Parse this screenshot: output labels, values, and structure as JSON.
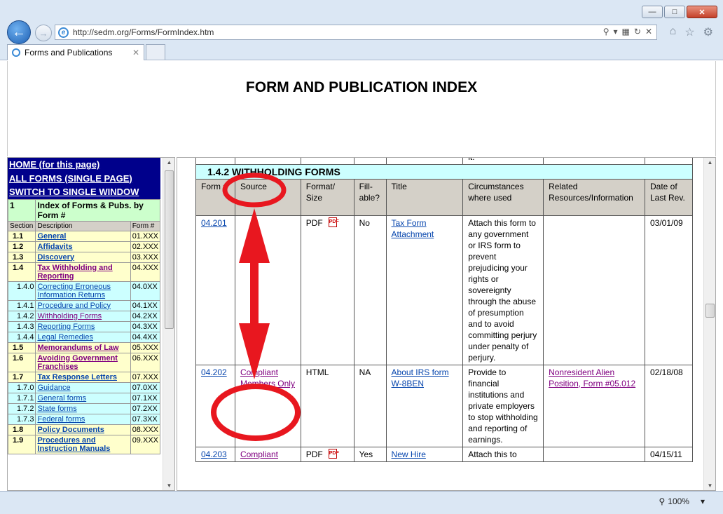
{
  "browser": {
    "url": "http://sedm.org/Forms/FormIndex.htm",
    "tab_title": "Forms and Publications",
    "zoom": "100%"
  },
  "page": {
    "title": "FORM AND PUBLICATION INDEX"
  },
  "left_nav": {
    "links": [
      "HOME (for this page)",
      "ALL FORMS (SINGLE PAGE)",
      "SWITCH TO SINGLE WINDOW"
    ],
    "index_header": {
      "num": "1",
      "label": "Index of Forms & Pubs. by Form #"
    },
    "columns": {
      "section": "Section",
      "description": "Description",
      "form": "Form #"
    },
    "rows": [
      {
        "sec": "1.1",
        "desc": "General",
        "form": "01.XXX",
        "style": "y"
      },
      {
        "sec": "1.2",
        "desc": "Affidavits",
        "form": "02.XXX",
        "style": "y"
      },
      {
        "sec": "1.3",
        "desc": "Discovery",
        "form": "03.XXX",
        "style": "y"
      },
      {
        "sec": "1.4",
        "desc": "Tax Withholding and Reporting",
        "form": "04.XXX",
        "style": "y",
        "visited": true
      },
      {
        "sec": "1.4.0",
        "desc": "Correcting Erroneous Information Returns",
        "form": "04.0XX",
        "style": "c"
      },
      {
        "sec": "1.4.1",
        "desc": "Procedure and Policy",
        "form": "04.1XX",
        "style": "c"
      },
      {
        "sec": "1.4.2",
        "desc": "Withholding Forms",
        "form": "04.2XX",
        "style": "c",
        "visited": true
      },
      {
        "sec": "1.4.3",
        "desc": "Reporting Forms",
        "form": "04.3XX",
        "style": "c"
      },
      {
        "sec": "1.4.4",
        "desc": "Legal Remedies",
        "form": "04.4XX",
        "style": "c"
      },
      {
        "sec": "1.5",
        "desc": "Memorandums of Law",
        "form": "05.XXX",
        "style": "y",
        "visited": true
      },
      {
        "sec": "1.6",
        "desc": "Avoiding Government Franchises",
        "form": "06.XXX",
        "style": "y",
        "visited": true
      },
      {
        "sec": "1.7",
        "desc": "Tax Response Letters",
        "form": "07.XXX",
        "style": "y"
      },
      {
        "sec": "1.7.0",
        "desc": "Guidance",
        "form": "07.0XX",
        "style": "c"
      },
      {
        "sec": "1.7.1",
        "desc": "General forms",
        "form": "07.1XX",
        "style": "c"
      },
      {
        "sec": "1.7.2",
        "desc": "State forms",
        "form": "07.2XX",
        "style": "c"
      },
      {
        "sec": "1.7.3",
        "desc": "Federal forms",
        "form": "07.3XX",
        "style": "c"
      },
      {
        "sec": "1.8",
        "desc": "Policy Documents",
        "form": "08.XXX",
        "style": "y"
      },
      {
        "sec": "1.9",
        "desc": "Procedures and Instruction Manuals",
        "form": "09.XXX",
        "style": "y"
      }
    ]
  },
  "main": {
    "stub_text": "it.",
    "section_title": "1.4.2 WITHHOLDING FORMS",
    "columns": [
      "Form #",
      "Source",
      "Format/ Size",
      "Fill- able?",
      "Title",
      "Circumstances where used",
      "Related Resources/Information",
      "Date of Last Rev."
    ],
    "rows": [
      {
        "form": "04.201",
        "source": "",
        "format": "PDF",
        "fillable": "No",
        "title": "Tax Form Attachment",
        "circumstances": "Attach this form to any government or IRS form to prevent prejudicing your rights or sovereignty through the abuse of presumption and to avoid committing perjury under penalty of perjury.",
        "related": "",
        "date": "03/01/09"
      },
      {
        "form": "04.202",
        "source": "Compliant Members Only",
        "format": "HTML",
        "fillable": "NA",
        "title": "About IRS form W-8BEN",
        "circumstances": "Provide to financial institutions and private employers to stop withholding and reporting of earnings.",
        "related": "Nonresident Alien Position, Form #05.012",
        "date": "02/18/08"
      },
      {
        "form": "04.203",
        "source": "Compliant",
        "format": "PDF",
        "fillable": "Yes",
        "title": "New Hire",
        "circumstances": "Attach this to",
        "related": "",
        "date": "04/15/11"
      }
    ]
  },
  "annotation": {
    "color": "#e8171f"
  }
}
